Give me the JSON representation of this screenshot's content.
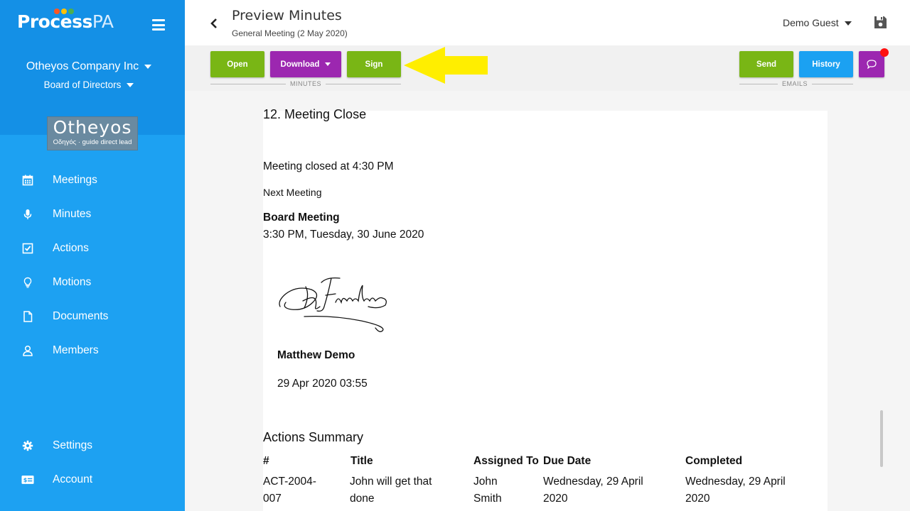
{
  "brand": {
    "name_a": "Process",
    "name_b": "PA",
    "dot_colors": [
      "#ff5722",
      "#ffc107",
      "#4caf50"
    ]
  },
  "sidebar": {
    "company": "Otheyos Company Inc",
    "board": "Board of Directors",
    "org_logo": {
      "name": "Otheyos",
      "tagline": "Οδηγός · guide direct lead"
    },
    "items": [
      {
        "label": "Meetings",
        "icon": "calendar-icon"
      },
      {
        "label": "Minutes",
        "icon": "microphone-icon"
      },
      {
        "label": "Actions",
        "icon": "checkbox-icon"
      },
      {
        "label": "Motions",
        "icon": "lightbulb-icon"
      },
      {
        "label": "Documents",
        "icon": "document-icon"
      },
      {
        "label": "Members",
        "icon": "person-icon"
      }
    ],
    "bottom_items": [
      {
        "label": "Settings",
        "icon": "gear-icon"
      },
      {
        "label": "Account",
        "icon": "billing-card-icon"
      }
    ]
  },
  "header": {
    "title": "Preview Minutes",
    "subtitle": "General Meeting (2 May 2020)",
    "user": "Demo Guest"
  },
  "toolbar": {
    "open": "Open",
    "download": "Download",
    "sign": "Sign",
    "minutes_group": "MINUTES",
    "send": "Send",
    "history": "History",
    "emails_group": "EMAILS"
  },
  "colors": {
    "sidebar": "#1da1f2",
    "sidebar_top": "#1490e6",
    "green": "#79b615",
    "purple": "#9c27b0",
    "blue": "#1ba1f2",
    "notification": "#ff1010",
    "arrow": "#ffee00"
  },
  "document": {
    "section_title": "12. Meeting Close",
    "closed_at": "Meeting closed at 4:30 PM",
    "next_meeting_label": "Next Meeting",
    "next_meeting_name": "Board Meeting",
    "next_meeting_time": "3:30 PM, Tuesday, 30 June 2020",
    "signer": "Matthew Demo",
    "signed_at": "29 Apr 2020 03:55",
    "actions_title": "Actions Summary",
    "columns": [
      "#",
      "Title",
      "Assigned To",
      "Due Date",
      "Completed"
    ],
    "rows": [
      {
        "id": [
          "ACT-2004-",
          "007"
        ],
        "title": [
          "John will get that",
          "done"
        ],
        "assigned": [
          "John",
          "Smith"
        ],
        "due": [
          "Wednesday, 29 April",
          "2020"
        ],
        "completed": [
          "Wednesday, 29 April",
          "2020"
        ]
      }
    ]
  }
}
